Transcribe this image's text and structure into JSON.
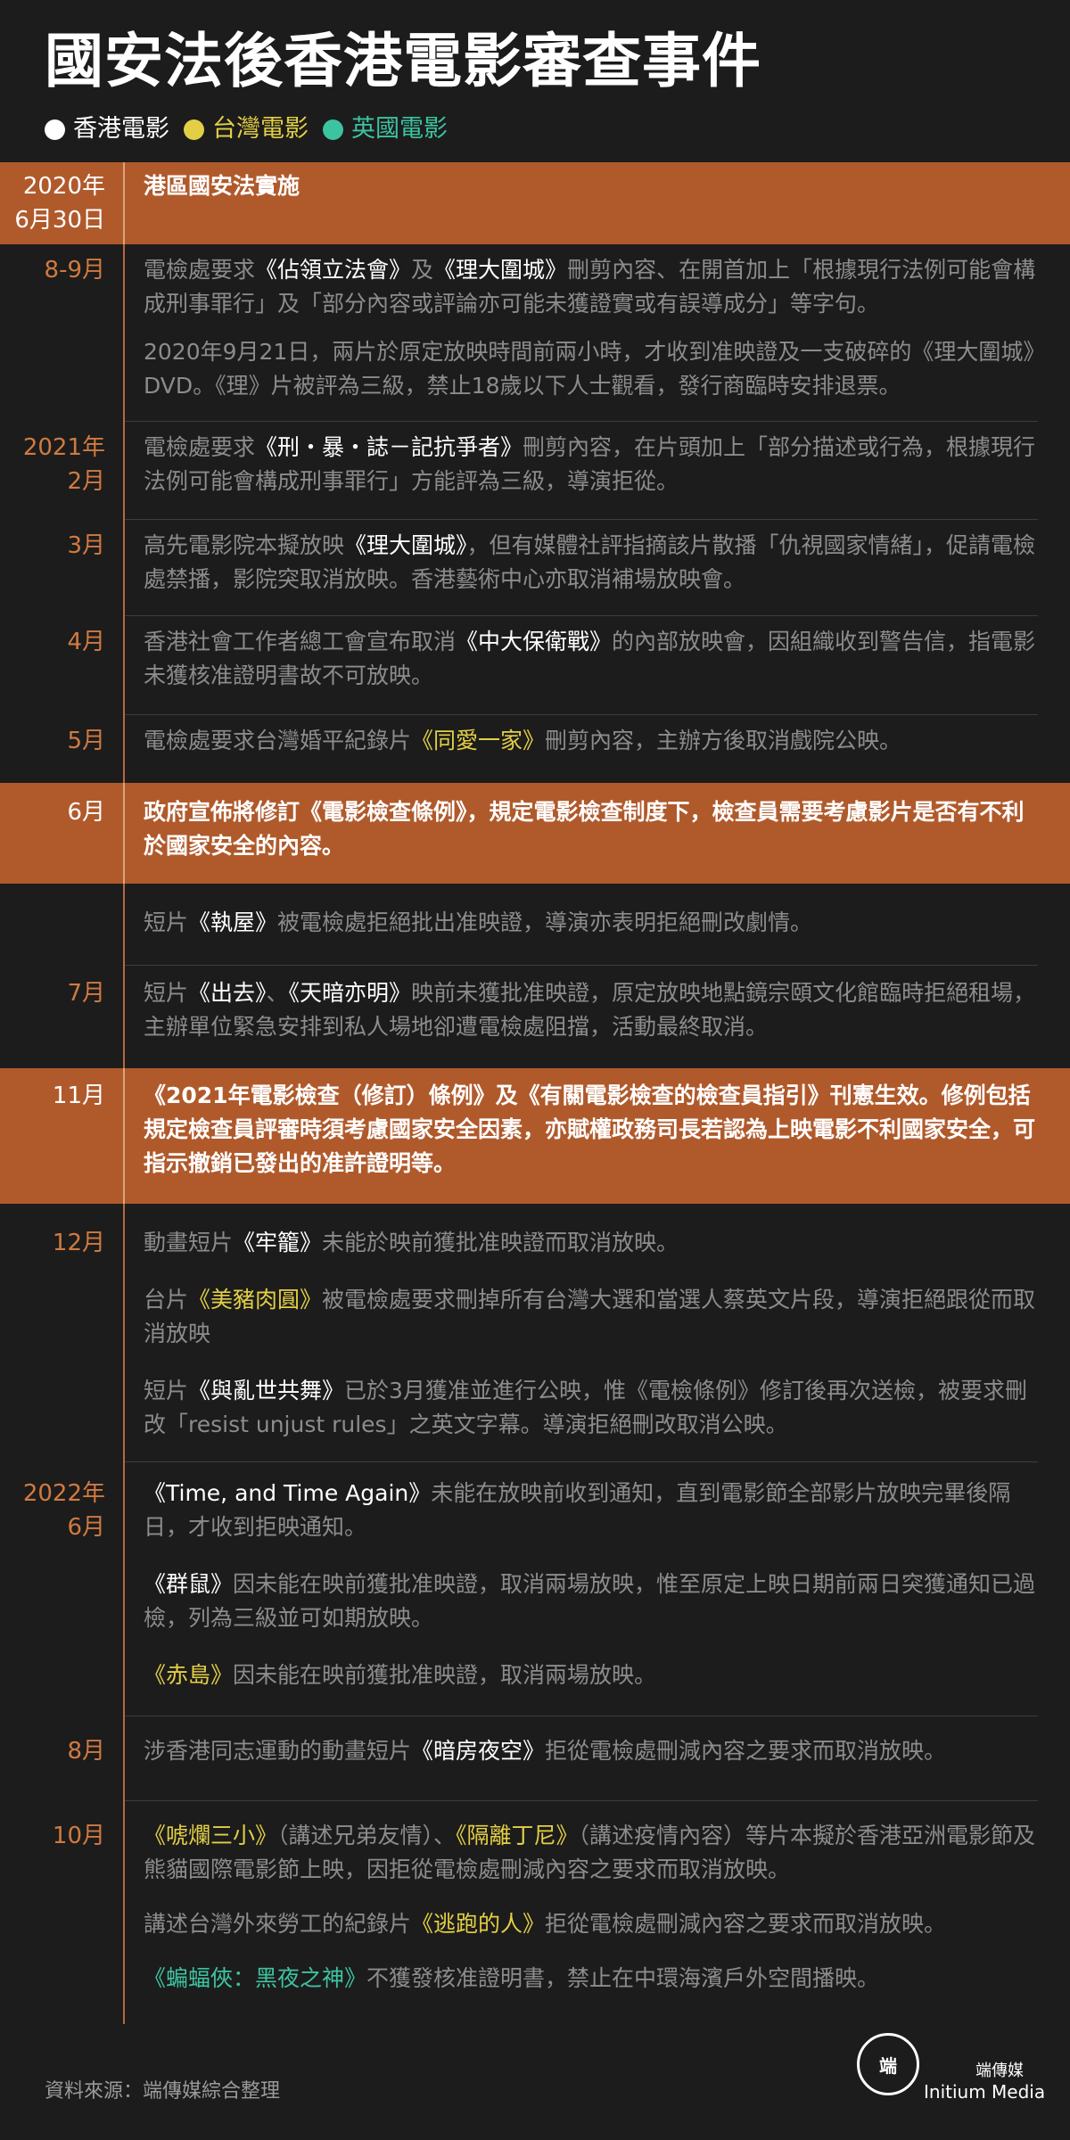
{
  "title": "國安法後香港電影審查事件",
  "legend": [
    {
      "label": "香港電影",
      "color": "#ffffff"
    },
    {
      "label": "台灣電影",
      "color": "#e3cf45"
    },
    {
      "label": "英國電影",
      "color": "#3cc3a0"
    }
  ],
  "colors": {
    "background": "#1c1c1c",
    "highlight_band": "#b05a2c",
    "date_text": "#d07a40"
  },
  "events": [
    {
      "date": "2020年\n6月30日",
      "highlight": true,
      "paragraphs": [
        [
          {
            "t": "港區國安法實施"
          }
        ]
      ]
    },
    {
      "date": "8-9月",
      "paragraphs": [
        [
          {
            "t": "電檢處要求"
          },
          {
            "t": "《佔領立法會》",
            "c": "w"
          },
          {
            "t": "及"
          },
          {
            "t": "《理大圍城》",
            "c": "w"
          },
          {
            "t": "刪剪內容、在開首加上「根據現行法例可能會構成刑事罪行」及「部分內容或評論亦可能未獲證實或有誤導成分」等字句。"
          }
        ],
        [
          {
            "t": "2020年9月21日，兩片於原定放映時間前兩小時，才收到准映證及一支破碎的《理大圍城》DVD。《理》片被評為三級，禁止18歲以下人士觀看，發行商臨時安排退票。"
          }
        ]
      ]
    },
    {
      "date": "2021年\n2月",
      "paragraphs": [
        [
          {
            "t": "電檢處要求"
          },
          {
            "t": "《刑・暴・誌－記抗爭者》",
            "c": "w"
          },
          {
            "t": "刪剪內容，在片頭加上「部分描述或行為，根據現行法例可能會構成刑事罪行」方能評為三級，導演拒從。"
          }
        ]
      ]
    },
    {
      "date": "3月",
      "paragraphs": [
        [
          {
            "t": "高先電影院本擬放映"
          },
          {
            "t": "《理大圍城》",
            "c": "w"
          },
          {
            "t": "，但有媒體社評指摘該片散播「仇視國家情緒」，促請電檢處禁播，影院突取消放映。香港藝術中心亦取消補場放映會。"
          }
        ]
      ]
    },
    {
      "date": "4月",
      "paragraphs": [
        [
          {
            "t": "香港社會工作者總工會宣布取消"
          },
          {
            "t": "《中大保衛戰》",
            "c": "w"
          },
          {
            "t": "的內部放映會，因組織收到警告信，指電影未獲核准證明書故不可放映。"
          }
        ]
      ]
    },
    {
      "date": "5月",
      "paragraphs": [
        [
          {
            "t": "電檢處要求台灣婚平紀錄片"
          },
          {
            "t": "《同愛一家》",
            "c": "y"
          },
          {
            "t": "刪剪內容，主辦方後取消戲院公映。"
          }
        ]
      ]
    },
    {
      "date": "6月",
      "highlight": true,
      "paragraphs": [
        [
          {
            "t": "政府宣佈將修訂《電影檢查條例》，規定電影檢查制度下，檢查員需要考慮影片是否有不利於國家安全的內容。"
          }
        ]
      ]
    },
    {
      "date": "",
      "paragraphs": [
        [
          {
            "t": "短片"
          },
          {
            "t": "《執屋》",
            "c": "w"
          },
          {
            "t": "被電檢處拒絕批出准映證，導演亦表明拒絕刪改劇情。"
          }
        ]
      ]
    },
    {
      "date": "7月",
      "paragraphs": [
        [
          {
            "t": "短片"
          },
          {
            "t": "《出去》",
            "c": "w"
          },
          {
            "t": "、"
          },
          {
            "t": "《天暗亦明》",
            "c": "w"
          },
          {
            "t": "映前未獲批准映證，原定放映地點鏡宗頤文化館臨時拒絕租場，主辦單位緊急安排到私人場地卻遭電檢處阻擋，活動最終取消。"
          }
        ]
      ]
    },
    {
      "date": "11月",
      "highlight": true,
      "paragraphs": [
        [
          {
            "t": "《2021年電影檢查（修訂）條例》及《有關電影檢查的檢查員指引》刊憲生效。修例包括規定檢查員評審時須考慮國家安全因素，亦賦權政務司長若認為上映電影不利國家安全，可指示撤銷已發出的准許證明等。"
          }
        ]
      ]
    },
    {
      "date": "12月",
      "paragraphs": [
        [
          {
            "t": "動畫短片"
          },
          {
            "t": "《牢籠》",
            "c": "w"
          },
          {
            "t": "未能於映前獲批准映證而取消放映。"
          }
        ],
        [
          {
            "t": "台片"
          },
          {
            "t": "《美豬肉圓》",
            "c": "y"
          },
          {
            "t": "被電檢處要求刪掉所有台灣大選和當選人蔡英文片段，導演拒絕跟從而取消放映"
          }
        ],
        [
          {
            "t": "短片"
          },
          {
            "t": "《與亂世共舞》",
            "c": "w"
          },
          {
            "t": "已於3月獲准並進行公映，惟《電檢條例》修訂後再次送檢，被要求刪改「resist unjust rules」之英文字幕。導演拒絕刪改取消公映。"
          }
        ]
      ]
    },
    {
      "date": "2022年\n6月",
      "paragraphs": [
        [
          {
            "t": "《Time, and Time Again》",
            "c": "w"
          },
          {
            "t": "未能在放映前收到通知，直到電影節全部影片放映完畢後隔日，才收到拒映通知。"
          }
        ],
        [
          {
            "t": "《群鼠》",
            "c": "w"
          },
          {
            "t": "因未能在映前獲批准映證，取消兩場放映，惟至原定上映日期前兩日突獲通知已過檢，列為三級並可如期放映。"
          }
        ],
        [
          {
            "t": "《赤島》",
            "c": "y"
          },
          {
            "t": "因未能在映前獲批准映證，取消兩場放映。"
          }
        ]
      ]
    },
    {
      "date": "8月",
      "paragraphs": [
        [
          {
            "t": "涉香港同志運動的動畫短片"
          },
          {
            "t": "《暗房夜空》",
            "c": "w"
          },
          {
            "t": "拒從電檢處刪減內容之要求而取消放映。"
          }
        ]
      ]
    },
    {
      "date": "10月",
      "paragraphs": [
        [
          {
            "t": "《唬爛三小》",
            "c": "y"
          },
          {
            "t": "（講述兄弟友情）、"
          },
          {
            "t": "《隔離丁尼》",
            "c": "y"
          },
          {
            "t": "（講述疫情內容）等片本擬於香港亞洲電影節及熊貓國際電影節上映，因拒從電檢處刪減內容之要求而取消放映。"
          }
        ],
        [
          {
            "t": "講述台灣外來勞工的紀錄片"
          },
          {
            "t": "《逃跑的人》",
            "c": "y"
          },
          {
            "t": "拒從電檢處刪減內容之要求而取消放映。"
          }
        ],
        [
          {
            "t": "《蝙蝠俠：黑夜之神》",
            "c": "t"
          },
          {
            "t": "不獲發核准證明書，禁止在中環海濱戶外空間播映。"
          }
        ]
      ]
    }
  ],
  "footer": {
    "source": "資料來源：端傳媒綜合整理",
    "logo_glyph": "端",
    "brand_cn": "端傳媒",
    "brand_en": "Initium Media"
  }
}
